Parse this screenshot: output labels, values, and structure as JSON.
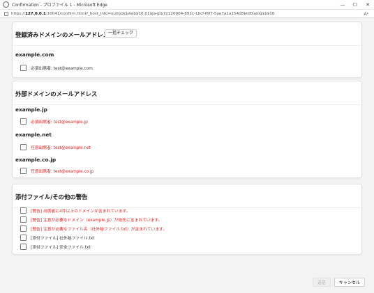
{
  "window": {
    "title": "Confirmation - プロファイル 1 - Microsoft Edge",
    "controls": [
      "—",
      "☐",
      "✕"
    ]
  },
  "address": {
    "prefix": "https://",
    "host": "127.0.0.1",
    "path": ":10041/confirm.html?_host_Info=outlook$web$16.01$ja-jp$72120904-891c-1bcf-f6f7-5ae7a1a154b8$idDialog$$$16"
  },
  "sections": {
    "registered": {
      "title": "登録済みドメインのメールアドレス",
      "bulk_check_label": "一括チェック",
      "groups": [
        {
          "domain": "example.com",
          "items": [
            {
              "label": "必須出席者: test@example.com",
              "red": false,
              "checked": false
            }
          ]
        }
      ]
    },
    "external": {
      "title": "外部ドメインのメールアドレス",
      "groups": [
        {
          "domain": "example.jp",
          "items": [
            {
              "label": "必須出席者: test@example.jp",
              "red": true,
              "checked": false
            }
          ]
        },
        {
          "domain": "example.net",
          "items": [
            {
              "label": "任意出席者: test@example.net",
              "red": true,
              "checked": false
            }
          ]
        },
        {
          "domain": "example.co.jp",
          "items": [
            {
              "label": "任意出席者: test@example.co.jp",
              "red": true,
              "checked": false
            }
          ]
        }
      ]
    },
    "attachments": {
      "title": "添付ファイル/その他の警告",
      "items": [
        {
          "label": "[警告] 出席者に4件以上のドメインが含まれています。",
          "red": true,
          "checked": false
        },
        {
          "label": "[警告] 注意が必要なドメイン（example.jp）が宛先に含まれています。",
          "red": true,
          "checked": false
        },
        {
          "label": "[警告] 注意が必要なファイル名（社外秘ファイル.txt）が含まれています。",
          "red": true,
          "checked": false
        },
        {
          "label": "[添付ファイル] 社外秘ファイル.txt",
          "red": false,
          "checked": false
        },
        {
          "label": "[添付ファイル] 安全ファイル.txt",
          "red": false,
          "checked": false
        }
      ]
    }
  },
  "footer": {
    "send_label": "送信",
    "cancel_label": "キャンセル"
  },
  "colors": {
    "warning_red": "#e02020",
    "page_background": "#f3f3f3"
  }
}
